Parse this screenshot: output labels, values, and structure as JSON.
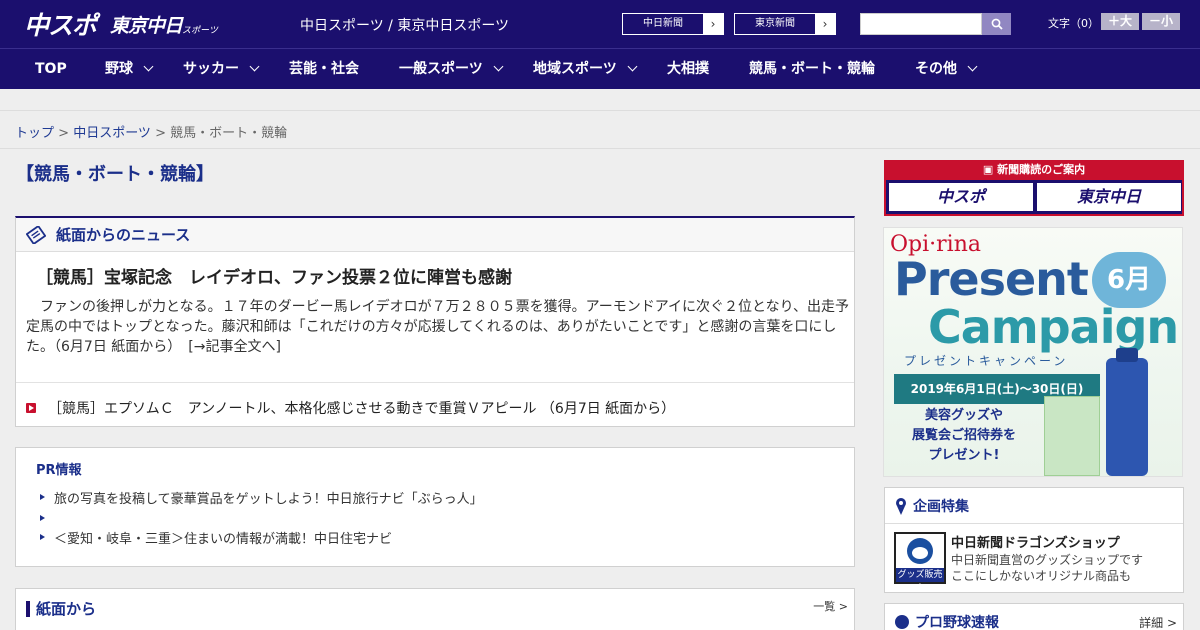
{
  "header": {
    "logo_main": "中スポ",
    "logo_sub": "東京中日",
    "logo_small": "スポーツ",
    "site_line": "中日スポーツ / 東京中日スポーツ",
    "paper_links": [
      {
        "label": "中日新聞"
      },
      {
        "label": "東京新聞"
      }
    ],
    "search": {
      "placeholder": "",
      "value": ""
    },
    "font_size_label": "文字（0）",
    "font_larger": "＋大",
    "font_smaller": "－小"
  },
  "nav": {
    "items": [
      {
        "label": "TOP"
      },
      {
        "label": "野球"
      },
      {
        "label": "サッカー"
      },
      {
        "label": "芸能・社会"
      },
      {
        "label": "一般スポーツ"
      },
      {
        "label": "地域スポーツ"
      },
      {
        "label": "大相撲"
      },
      {
        "label": "競馬・ボート・競輪"
      },
      {
        "label": "その他"
      }
    ]
  },
  "breadcrumb": {
    "top": "トップ",
    "sep": " > ",
    "section": "中日スポーツ",
    "current": "競馬・ボート・競輪"
  },
  "page_title": "【競馬・ボート・競輪】",
  "news": {
    "heading": "紙面からのニュース",
    "lead_title": "［競馬］宝塚記念　レイデオロ、ファン投票２位に陣営も感謝",
    "lead_body": "ファンの後押しが力となる。１７年のダービー馬レイデオロが７万２８０５票を獲得。アーモンドアイに次ぐ２位となり、出走予定馬の中ではトップとなった。藤沢和師は「これだけの方々が応援してくれるのは、ありがたいことです」と感謝の言葉を口にした。（6月7日 紙面から）　[→記事全文へ]",
    "items": [
      {
        "label": "［競馬］エプソムＣ　アンノートル、本格化感じさせる動きで重賞Ｖアピール （6月7日 紙面から）"
      }
    ]
  },
  "pr": {
    "heading": "PR情報",
    "items": [
      {
        "label": "旅の写真を投稿して豪華賞品をゲットしよう！中日旅行ナビ「ぶらっ人」"
      },
      {
        "label": ""
      },
      {
        "label": "＜愛知・岐阜・三重＞住まいの情報が満載！中日住宅ナビ"
      }
    ]
  },
  "section_from_paper": {
    "heading": "紙面から",
    "more": "一覧 >"
  },
  "sidebar": {
    "subscribe": {
      "heading": "新聞購読のご案内",
      "btn1": "中スポ",
      "btn2": "東京中日"
    },
    "ad": {
      "brand": "Opi·rina",
      "line1": "Present",
      "line2": "Campaign",
      "sub": "プレゼントキャンペーン",
      "month": "6月",
      "period": "2019年6月1日(土)〜30日(日)",
      "promo": "美容グッズや\n展覧会ご招待券を\nプレゼント!"
    },
    "kikaku": {
      "heading": "企画特集",
      "item_title": "中日新聞ドラゴンズショップ",
      "item_desc1": "中日新聞直営のグッズショップです",
      "item_desc2": "ここにしかないオリジナル商品も",
      "img_tag": "グッズ販売中"
    },
    "baseball": {
      "heading": "プロ野球速報",
      "detail": "詳細 >"
    }
  },
  "colors": {
    "brand_navy": "#1b0f6e",
    "accent_red": "#c8102e",
    "link_blue": "#1f3a93"
  }
}
